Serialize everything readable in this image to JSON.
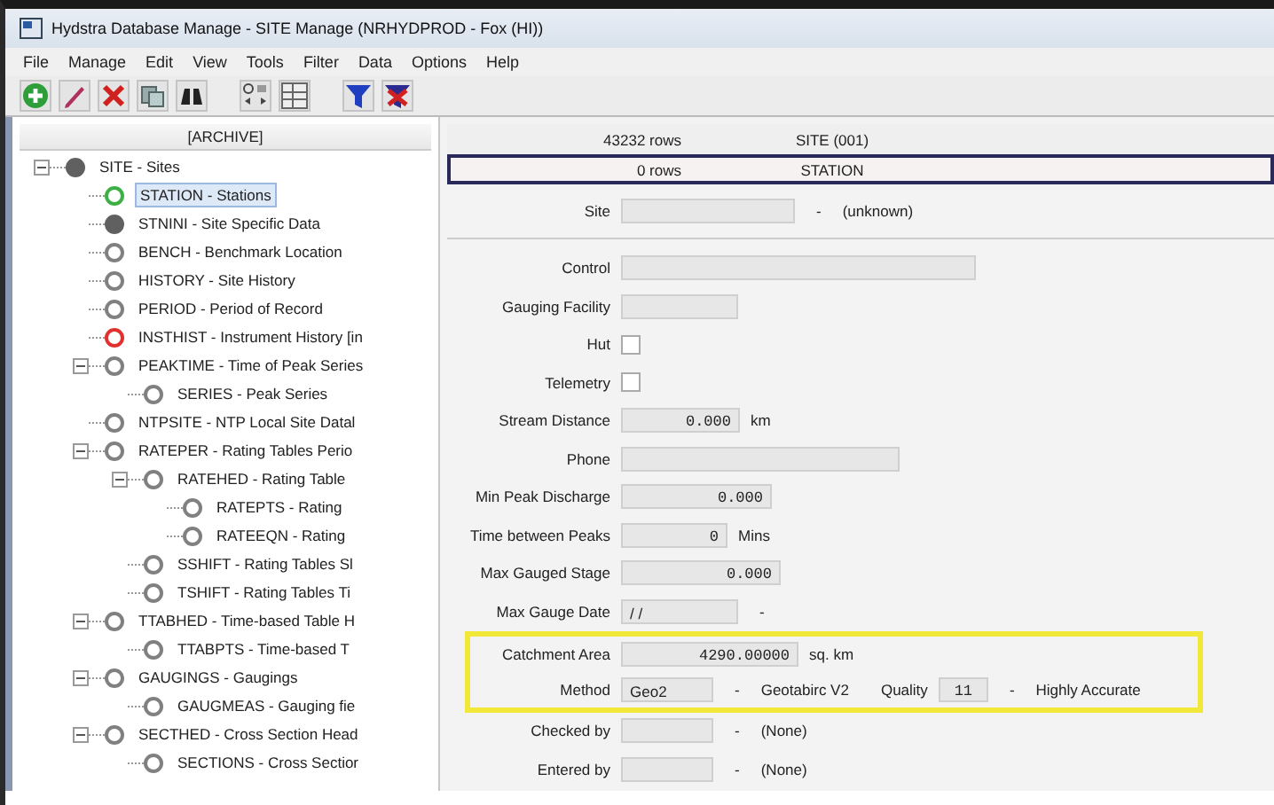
{
  "window": {
    "title": "Hydstra Database Manage - SITE Manage (NRHYDPROD - Fox (HI))"
  },
  "menu": [
    "File",
    "Manage",
    "Edit",
    "View",
    "Tools",
    "Filter",
    "Data",
    "Options",
    "Help"
  ],
  "tree": {
    "header": "[ARCHIVE]",
    "items": [
      {
        "label": "SITE - Sites",
        "color": "#606060",
        "filled": true,
        "selected": false,
        "expanded": true,
        "children": [
          {
            "label": "STATION - Stations",
            "color": "#3cb043",
            "filled": false,
            "selected": true
          },
          {
            "label": "STNINI - Site Specific Data",
            "color": "#606060",
            "filled": true,
            "selected": false
          },
          {
            "label": "BENCH - Benchmark Location",
            "color": "#808080",
            "filled": false,
            "selected": false
          },
          {
            "label": "HISTORY - Site History",
            "color": "#808080",
            "filled": false,
            "selected": false
          },
          {
            "label": "PERIOD - Period of Record",
            "color": "#808080",
            "filled": false,
            "selected": false
          },
          {
            "label": "INSTHIST - Instrument History [in",
            "color": "#e03030",
            "filled": false,
            "selected": false
          },
          {
            "label": "PEAKTIME - Time of Peak Series",
            "color": "#808080",
            "filled": false,
            "selected": false,
            "expanded": true,
            "children": [
              {
                "label": "SERIES - Peak Series",
                "color": "#808080",
                "filled": false,
                "selected": false
              }
            ]
          },
          {
            "label": "NTPSITE - NTP Local Site Datal",
            "color": "#808080",
            "filled": false,
            "selected": false
          },
          {
            "label": "RATEPER - Rating Tables Perio",
            "color": "#808080",
            "filled": false,
            "selected": false,
            "expanded": true,
            "children": [
              {
                "label": "RATEHED - Rating Table",
                "color": "#808080",
                "filled": false,
                "selected": false,
                "expanded": true,
                "children": [
                  {
                    "label": "RATEPTS - Rating",
                    "color": "#808080",
                    "filled": false,
                    "selected": false
                  },
                  {
                    "label": "RATEEQN - Rating",
                    "color": "#808080",
                    "filled": false,
                    "selected": false
                  }
                ]
              },
              {
                "label": "SSHIFT - Rating Tables Sl",
                "color": "#808080",
                "filled": false,
                "selected": false
              },
              {
                "label": "TSHIFT - Rating Tables Ti",
                "color": "#808080",
                "filled": false,
                "selected": false
              }
            ]
          },
          {
            "label": "TTABHED - Time-based Table H",
            "color": "#808080",
            "filled": false,
            "selected": false,
            "expanded": true,
            "children": [
              {
                "label": "TTABPTS - Time-based T",
                "color": "#808080",
                "filled": false,
                "selected": false
              }
            ]
          },
          {
            "label": "GAUGINGS - Gaugings",
            "color": "#808080",
            "filled": false,
            "selected": false,
            "expanded": true,
            "children": [
              {
                "label": "GAUGMEAS - Gauging fie",
                "color": "#808080",
                "filled": false,
                "selected": false
              }
            ]
          },
          {
            "label": "SECTHED - Cross Section Head",
            "color": "#808080",
            "filled": false,
            "selected": false,
            "expanded": true,
            "children": [
              {
                "label": "SECTIONS - Cross Sectior",
                "color": "#808080",
                "filled": false,
                "selected": false
              }
            ]
          }
        ]
      }
    ]
  },
  "table_rows": [
    {
      "count": "43232 rows",
      "name": "SITE (001)",
      "selected": false
    },
    {
      "count": "0 rows",
      "name": "STATION",
      "selected": true
    }
  ],
  "site": {
    "label": "Site",
    "separator": "-",
    "description": "(unknown)"
  },
  "fields": [
    {
      "kind": "text",
      "label": "Control"
    },
    {
      "kind": "text",
      "label": "Gauging Facility"
    },
    {
      "kind": "checkbox",
      "label": "Hut",
      "checked": false
    },
    {
      "kind": "checkbox",
      "label": "Telemetry",
      "checked": false
    },
    {
      "kind": "text",
      "label": "Stream Distance",
      "value": "0.000",
      "unit": "km"
    },
    {
      "kind": "text",
      "label": "Phone"
    },
    {
      "kind": "text",
      "label": "Min Peak Discharge",
      "value": "0.000"
    },
    {
      "kind": "text",
      "label": "Time between Peaks",
      "value": "0",
      "unit": "Mins"
    },
    {
      "kind": "text",
      "label": "Max Gauged Stage",
      "value": "0.000"
    },
    {
      "kind": "date",
      "label": "Max Gauge Date",
      "value": "/ /",
      "separator": "-"
    }
  ],
  "highlighted_fields": [
    {
      "kind": "text",
      "label": "Catchment Area",
      "value": "4290.00000",
      "unit": "sq. km"
    },
    {
      "kind": "method",
      "label": "Method",
      "value": "Geo2",
      "separator": "-",
      "description": "Geotabirc V2",
      "quality_label": "Quality",
      "quality_value": "11",
      "quality_separator": "-",
      "quality_description": "Highly Accurate"
    }
  ],
  "trailing_fields": [
    {
      "kind": "lookup",
      "label": "Checked by",
      "separator": "-",
      "description": "(None)"
    },
    {
      "kind": "lookup",
      "label": "Entered by",
      "separator": "-",
      "description": "(None)"
    }
  ]
}
